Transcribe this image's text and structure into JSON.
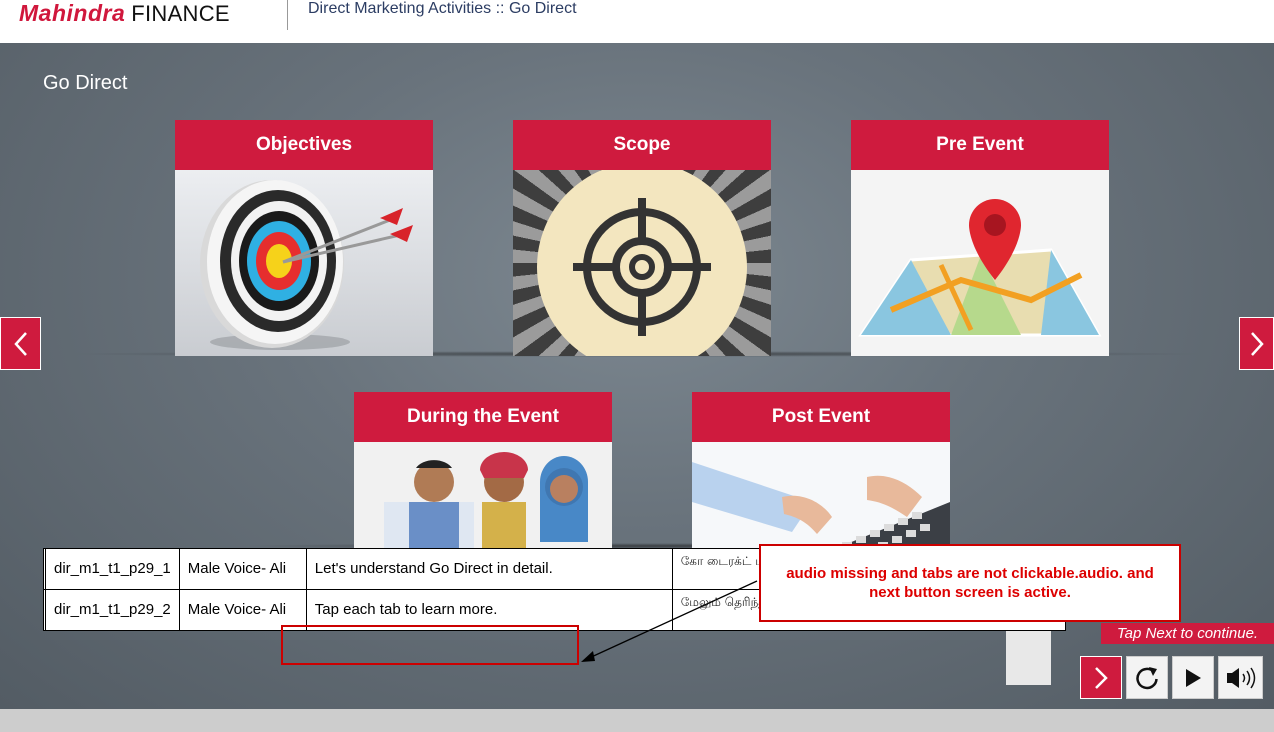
{
  "header": {
    "brand_name": "Mahindra",
    "brand_suffix": "FINANCE",
    "course_title": "Direct Marketing Activities :: Go Direct"
  },
  "page": {
    "title": "Go Direct"
  },
  "tiles": [
    {
      "label": "Objectives",
      "image": "archery-target-with-arrows"
    },
    {
      "label": "Scope",
      "image": "crosshair-scope"
    },
    {
      "label": "Pre Event",
      "image": "map-with-pin"
    },
    {
      "label": "During the Event",
      "image": "people-looking-at-screen"
    },
    {
      "label": "Post Event",
      "image": "hands-typing-keyboard"
    }
  ],
  "nav": {
    "prev_icon": "chevron-left-icon",
    "next_icon": "chevron-right-icon"
  },
  "script_rows": [
    {
      "id": "dir_m1_t1_p29_1",
      "voice": "Male Voice- Ali",
      "english": "Let's understand Go Direct in detail.",
      "tamil": "கோ டைரக்ட் ப"
    },
    {
      "id": "dir_m1_t1_p29_2",
      "voice": "Male Voice- Ali",
      "english": "Tap each tab to learn more.",
      "tamil": "மேலும் தெரிந்துகொள்ள, ஒவ்வொரு டாபின் மீதும் தட்டவும்."
    }
  ],
  "annotation": {
    "text": "audio missing and tabs are not clickable.audio. and next button screen is active."
  },
  "instruction": {
    "text": "Tap Next to continue."
  },
  "controls": [
    {
      "name": "next-button",
      "icon": "chevron-right-icon"
    },
    {
      "name": "replay-button",
      "icon": "replay-icon"
    },
    {
      "name": "play-button",
      "icon": "play-icon"
    },
    {
      "name": "audio-button",
      "icon": "speaker-icon"
    }
  ],
  "colors": {
    "accent": "#cf1b3e",
    "brand": "#d0173c",
    "annotation": "#dd0000"
  }
}
